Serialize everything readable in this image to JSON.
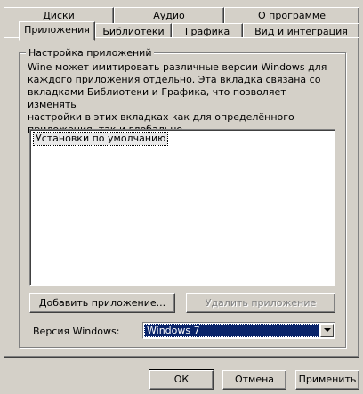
{
  "tabs_row_top": [
    {
      "label": "Диски"
    },
    {
      "label": "Аудио"
    },
    {
      "label": "О программе"
    }
  ],
  "tabs_row_bottom": [
    {
      "label": "Приложения",
      "active": true
    },
    {
      "label": "Библиотеки"
    },
    {
      "label": "Графика"
    },
    {
      "label": "Вид и интеграция"
    }
  ],
  "group": {
    "title": "Настройка приложений",
    "description": "Wine может имитировать различные версии Windows для\nкаждого приложения отдельно. Эта вкладка связана со\nвкладками Библиотеки и Графика, что позволяет изменять\nнастройки в этих вкладках как для определённого\nприложения, так и глобально."
  },
  "app_list": {
    "items": [
      "Установки по умолчанию"
    ]
  },
  "buttons": {
    "add_app": "Добавить приложение...",
    "remove_app": "Удалить приложение"
  },
  "version": {
    "label": "Версия Windows:",
    "selected": "Windows 7"
  },
  "footer": {
    "ok": "ОК",
    "cancel": "Отмена",
    "apply": "Применить"
  },
  "colors": {
    "dialog_bg": "#d4d0c8",
    "selection_bg": "#0a246a",
    "disabled_text": "#808080"
  }
}
